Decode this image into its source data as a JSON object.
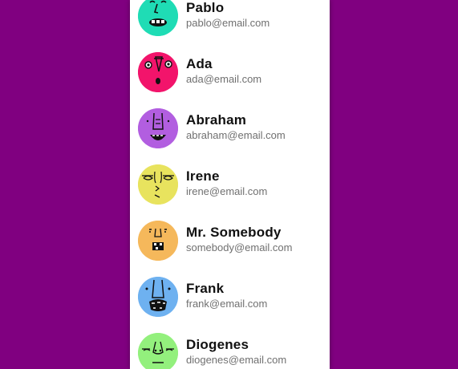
{
  "contacts": [
    {
      "name": "Pablo",
      "email": "pablo@email.com",
      "color": "#1fdcb5",
      "icon": "pablo-face-icon"
    },
    {
      "name": "Ada",
      "email": "ada@email.com",
      "color": "#f2146b",
      "icon": "ada-face-icon"
    },
    {
      "name": "Abraham",
      "email": "abraham@email.com",
      "color": "#b25ee0",
      "icon": "abraham-face-icon"
    },
    {
      "name": "Irene",
      "email": "irene@email.com",
      "color": "#e8e35e",
      "icon": "irene-face-icon"
    },
    {
      "name": "Mr. Somebody",
      "email": "somebody@email.com",
      "color": "#f5b85b",
      "icon": "somebody-face-icon"
    },
    {
      "name": "Frank",
      "email": "frank@email.com",
      "color": "#6eb1f0",
      "icon": "frank-face-icon"
    },
    {
      "name": "Diogenes",
      "email": "diogenes@email.com",
      "color": "#93f07d",
      "icon": "diogenes-face-icon"
    }
  ],
  "colors": {
    "background": "#800080",
    "panel": "#ffffff"
  }
}
